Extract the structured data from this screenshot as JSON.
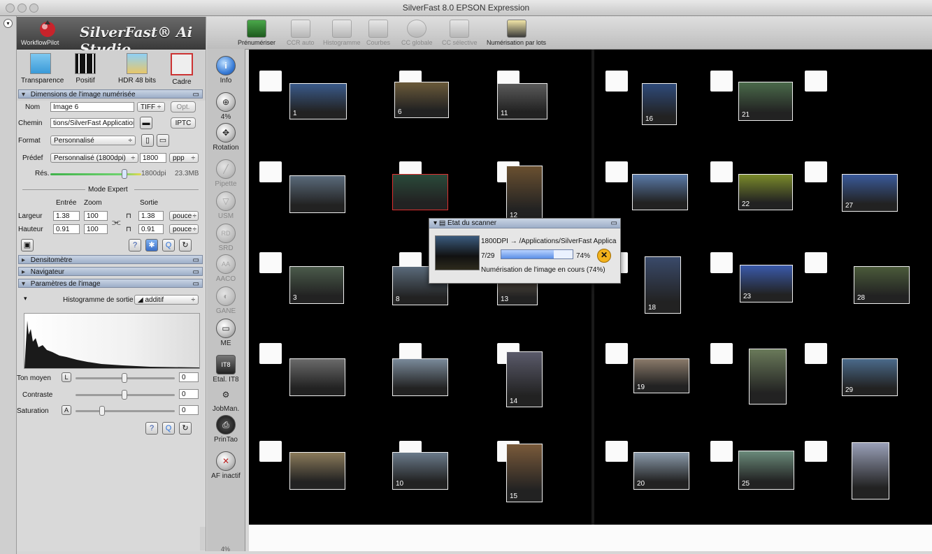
{
  "window": {
    "title": "SilverFast 8.0 EPSON Expression"
  },
  "brand": {
    "title": "SilverFast® Ai Studio",
    "workflow_pilot": "WorkflowPilot"
  },
  "modes": [
    {
      "label": "Transparence",
      "icon": "slide-icon"
    },
    {
      "label": "Positif",
      "icon": "film-icon"
    },
    {
      "label": "HDR 48 bits",
      "icon": "hdr-icon"
    },
    {
      "label": "Cadre",
      "icon": "tools-icon"
    }
  ],
  "sections": {
    "dimensions": "Dimensions de l'image numérisée",
    "densitometer": "Densitomètre",
    "navigator": "Navigateur",
    "image_params": "Paramètres de l'image"
  },
  "dimensions": {
    "nom_label": "Nom",
    "nom_value": "Image 6",
    "format_file": "TIFF",
    "opt_label": "Opt.",
    "chemin_label": "Chemin",
    "chemin_value": "tions/SilverFast Application",
    "iptc_label": "IPTC",
    "format_label": "Format",
    "format_value": "Personnalisé",
    "predef_label": "Prédef",
    "predef_value": "Personnalisé (1800dpi)",
    "predef_dpi": "1800",
    "predef_unit": "ppp",
    "res_label": "Rés.",
    "res_value": "1800dpi",
    "res_size": "23.3MB",
    "mode_expert": "Mode Expert",
    "col_entree": "Entrée",
    "col_zoom": "Zoom",
    "col_sortie": "Sortie",
    "largeur_label": "Largeur",
    "largeur_in": "1.38",
    "largeur_zoom": "100",
    "largeur_out": "1.38",
    "largeur_unit": "pouce",
    "hauteur_label": "Hauteur",
    "hauteur_in": "0.91",
    "hauteur_zoom": "100",
    "hauteur_out": "0.91",
    "hauteur_unit": "pouce"
  },
  "image_params": {
    "hist_label": "Histogramme de sortie",
    "hist_mode": "additif",
    "ton_moyen_label": "Ton moyen",
    "ton_moyen_value": "0",
    "contraste_label": "Contraste",
    "contraste_value": "0",
    "saturation_label": "Saturation",
    "saturation_value": "0"
  },
  "toolbar": [
    {
      "label": "Prénumériser",
      "enabled": true
    },
    {
      "label": "CCR auto",
      "enabled": false
    },
    {
      "label": "Histogramme",
      "enabled": false
    },
    {
      "label": "Courbes",
      "enabled": false
    },
    {
      "label": "CC globale",
      "enabled": false
    },
    {
      "label": "CC sélective",
      "enabled": false
    },
    {
      "label": "Numérisation par lots",
      "enabled": true
    }
  ],
  "tools": [
    {
      "label": "Info",
      "glyph": "i",
      "enabled": true
    },
    {
      "label": "4%",
      "glyph": "⊕",
      "enabled": true
    },
    {
      "label": "Rotation",
      "glyph": "✥",
      "enabled": true
    },
    {
      "label": "Pipette",
      "glyph": "╱",
      "enabled": false
    },
    {
      "label": "USM",
      "glyph": "▽",
      "enabled": false
    },
    {
      "label": "SRD",
      "glyph": "RD",
      "enabled": false
    },
    {
      "label": "AACO",
      "glyph": "AA",
      "enabled": false
    },
    {
      "label": "GANE",
      "glyph": "◐",
      "enabled": false
    },
    {
      "label": "ME",
      "glyph": "▭",
      "enabled": true
    },
    {
      "label": "Etal. IT8",
      "glyph": "IT8",
      "enabled": true
    },
    {
      "label": "JobMan.",
      "glyph": "⚙",
      "enabled": true
    },
    {
      "label": "PrinTao",
      "glyph": "⎙",
      "enabled": true
    },
    {
      "label": "AF inactif",
      "glyph": "✕",
      "enabled": true
    }
  ],
  "status_bottom": "4%",
  "frames": [
    {
      "num": "1"
    },
    {
      "num": "6"
    },
    {
      "num": "11"
    },
    {
      "num": "16"
    },
    {
      "num": "21"
    },
    {
      "num": ""
    },
    {
      "num": ""
    },
    {
      "num": "12"
    },
    {
      "num": ""
    },
    {
      "num": "22"
    },
    {
      "num": "27"
    },
    {
      "num": "3"
    },
    {
      "num": "8"
    },
    {
      "num": "13"
    },
    {
      "num": "18"
    },
    {
      "num": "23"
    },
    {
      "num": "28"
    },
    {
      "num": ""
    },
    {
      "num": ""
    },
    {
      "num": "14"
    },
    {
      "num": "19"
    },
    {
      "num": ""
    },
    {
      "num": "29"
    },
    {
      "num": ""
    },
    {
      "num": "10"
    },
    {
      "num": "15"
    },
    {
      "num": "20"
    },
    {
      "num": "25"
    },
    {
      "num": ""
    }
  ],
  "scanner_status": {
    "title": "Etat du scanner",
    "path": "1800DPI → /Applications/SilverFast Applica",
    "count": "7/29",
    "percent": "74%",
    "progress_fraction": 0.74,
    "message": "Numérisation de l'image en cours (74%)"
  }
}
